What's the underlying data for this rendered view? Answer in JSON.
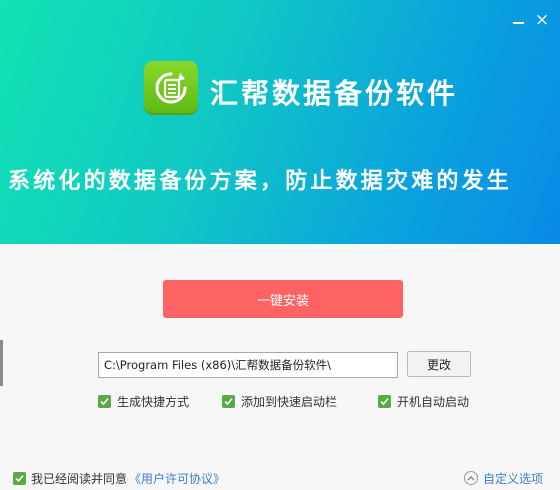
{
  "window": {
    "minimize_glyph": "minimize-icon",
    "close_glyph": "×"
  },
  "banner": {
    "app_title": "汇帮数据备份软件",
    "slogan": "系统化的数据备份方案，防止数据灾难的发生",
    "logo_icon": "backup-list-icon",
    "gradient_start": "#12e3b2",
    "gradient_end": "#0a8ae6"
  },
  "install": {
    "button_label": "一键安装",
    "button_color": "#fd6363",
    "path_value": "C:\\Program Files (x86)\\汇帮数据备份软件\\",
    "change_label": "更改"
  },
  "options": [
    {
      "label": "生成快捷方式",
      "checked": true
    },
    {
      "label": "添加到快速启动栏",
      "checked": true
    },
    {
      "label": "开机自动启动",
      "checked": true
    }
  ],
  "footer": {
    "agree_text": "我已经阅读并同意",
    "license_link": "《用户许可协议》",
    "agree_checked": true,
    "custom_options": "自定义选项"
  },
  "colors": {
    "checkbox": "#5aa84a",
    "link": "#3a7fd0"
  }
}
